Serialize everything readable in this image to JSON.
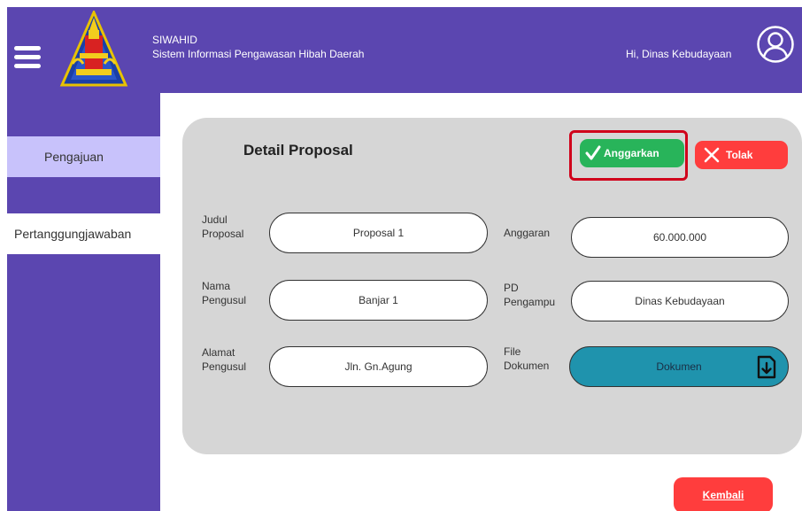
{
  "header": {
    "app_name": "SIWAHID",
    "app_subtitle": "Sistem Informasi Pengawasan Hibah Daerah",
    "greeting": "Hi, Dinas Kebudayaan",
    "icons": [
      "menu-icon",
      "logo",
      "user-account-icon"
    ]
  },
  "sidebar": {
    "items": [
      {
        "label": "Pengajuan",
        "active": true
      },
      {
        "label": "Pertanggungjawaban",
        "active": false
      }
    ]
  },
  "detail": {
    "title": "Detail Proposal",
    "approve_label": "Anggarkan",
    "reject_label": "Tolak",
    "fields": {
      "judul_label_1": "Judul",
      "judul_label_2": "Proposal",
      "judul_value": "Proposal 1",
      "nama_label_1": "Nama",
      "nama_label_2": "Pengusul",
      "nama_value": "Banjar 1",
      "alamat_label_1": "Alamat",
      "alamat_label_2": "Pengusul",
      "alamat_value": "Jln. Gn.Agung",
      "anggaran_label": "Anggaran",
      "anggaran_value": "60.000.000",
      "pd_label_1": "PD",
      "pd_label_2": "Pengampu",
      "pd_value": "Dinas Kebudayaan",
      "file_label_1": "File",
      "file_label_2": "Dokumen",
      "file_value": "Dokumen"
    }
  },
  "footer": {
    "back_label": "Kembali"
  },
  "colors": {
    "primary": "#5b46b0",
    "sidebar_active": "#c8c2fb",
    "card": "#d6d6d6",
    "approve": "#28b45a",
    "reject": "#ff3d3d",
    "document": "#1f93ad",
    "highlight": "#d0021b"
  }
}
